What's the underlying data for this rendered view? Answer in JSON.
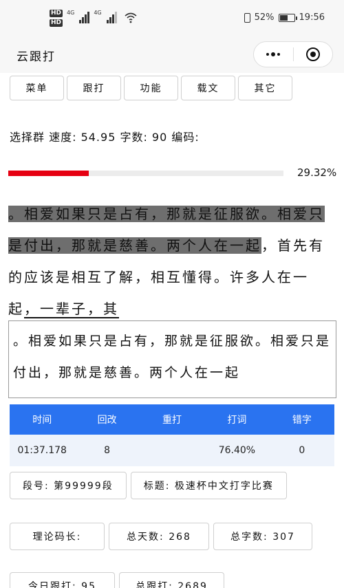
{
  "status_bar": {
    "net1": "4G",
    "net2": "4G",
    "hd1": "HD",
    "hd2": "HD",
    "battery": "52%",
    "time": "19:56"
  },
  "nav": {
    "title": "云跟打"
  },
  "menu": {
    "items": [
      "菜单",
      "跟打",
      "功能",
      "载文",
      "其它"
    ]
  },
  "statline": "选择群 速度: 54.95 字数: 90 编码:",
  "progress": {
    "percent_label": "29.32%",
    "value": 0.2932
  },
  "article": {
    "typed": "。相爱如果只是占有，那就是征服欲。相爱只是付出，那就是慈善。两个人在一起",
    "rest": "，首先有的应该是相互了解，相互懂得。许多人在一起",
    "current": "，一辈子，其"
  },
  "input_text": "。相爱如果只是占有，那就是征服欲。相爱只是付出，那就是慈善。两个人在一起",
  "table": {
    "headers": [
      "时间",
      "回改",
      "重打",
      "打词",
      "错字"
    ],
    "row": [
      "01:37.178",
      "8",
      "",
      "76.40%",
      "0"
    ]
  },
  "info": {
    "segment": "段号: 第99999段",
    "title": "标题: 极速杯中文打字比赛",
    "code_len": "理论码长:",
    "total_days": "总天数: 268",
    "total_chars": "总字数: 307",
    "today": "今日跟打: 95",
    "total_follow": "总跟打: 2689"
  },
  "colors": {
    "accent_blue": "#2a73f0",
    "progress_red": "#e60012",
    "typed_highlight": "#6e6e6e"
  }
}
